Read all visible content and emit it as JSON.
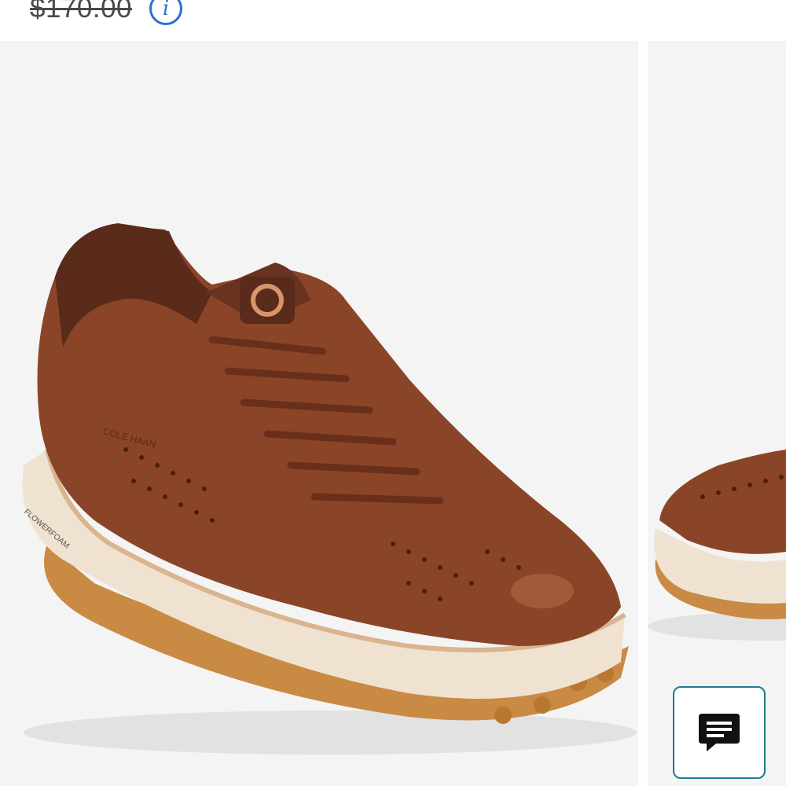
{
  "product": {
    "original_price": "$170.00",
    "info_icon": "info-icon"
  },
  "gallery": {
    "images": [
      {
        "label": "brown leather perforated sneaker, three-quarter view",
        "icon": "product-image"
      },
      {
        "label": "brown leather perforated sneaker, side view",
        "icon": "product-image"
      }
    ],
    "sole_branding": "FLOWERFOAM",
    "upper_branding": "COLE HAAN"
  },
  "chat": {
    "icon": "chat-icon"
  },
  "colors": {
    "price_text": "#4a4a4a",
    "info_accent": "#2a6fd6",
    "chat_border": "#1f7a8c",
    "image_bg": "#f4f4f4",
    "leather": "#8a4528",
    "sole": "#efe2d0",
    "outsole": "#c98a44"
  }
}
